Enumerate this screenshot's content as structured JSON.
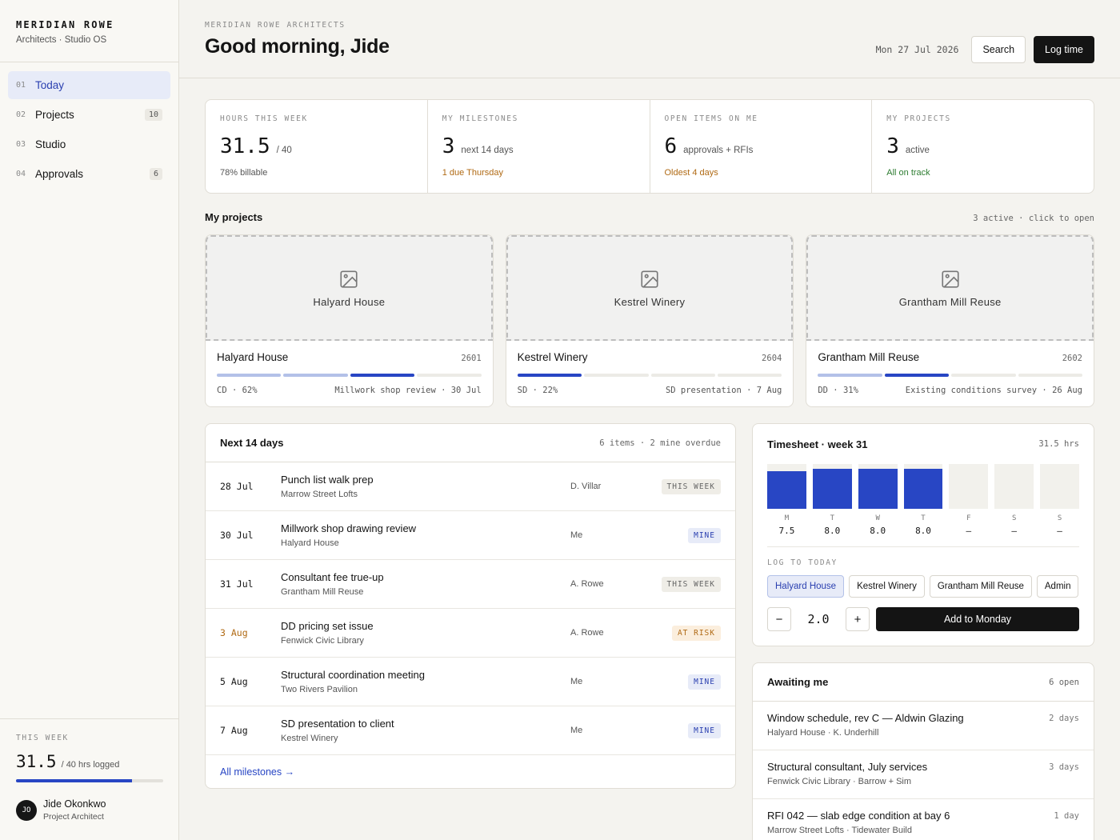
{
  "brand": {
    "name": "MERIDIAN ROWE",
    "sub": "Architects · Studio OS"
  },
  "nav": [
    {
      "num": "01",
      "label": "Today",
      "badge": "",
      "active": true
    },
    {
      "num": "02",
      "label": "Projects",
      "badge": "10"
    },
    {
      "num": "03",
      "label": "Studio",
      "badge": ""
    },
    {
      "num": "04",
      "label": "Approvals",
      "badge": "6"
    }
  ],
  "sidebar_week": {
    "label": "THIS WEEK",
    "hours": "31.5",
    "suffix": "/ 40 hrs logged",
    "progress": 0.7875
  },
  "user": {
    "initials": "JO",
    "name": "Jide Okonkwo",
    "role": "Project Architect"
  },
  "header": {
    "overline": "MERIDIAN ROWE ARCHITECTS",
    "greeting": "Good morning, Jide",
    "date": "Mon 27 Jul 2026",
    "search_label": "Search",
    "log_label": "Log time"
  },
  "stats": [
    {
      "label": "HOURS THIS WEEK",
      "value": "31.5",
      "unit": "/ 40",
      "note": "78% billable",
      "tone": ""
    },
    {
      "label": "MY MILESTONES",
      "value": "3",
      "unit": "next 14 days",
      "note": "1 due Thursday",
      "tone": "amber"
    },
    {
      "label": "OPEN ITEMS ON ME",
      "value": "6",
      "unit": "approvals + RFIs",
      "note": "Oldest 4 days",
      "tone": "amber"
    },
    {
      "label": "MY PROJECTS",
      "value": "3",
      "unit": "active",
      "note": "All on track",
      "tone": "green"
    }
  ],
  "projects_section": {
    "title": "My projects",
    "meta": "3 active · click to open"
  },
  "projects": [
    {
      "name": "Halyard House",
      "code": "2601",
      "phase": "CD · 62%",
      "next": "Millwork shop review · 30 Jul",
      "segments": [
        "done",
        "done",
        "cur",
        "todo"
      ]
    },
    {
      "name": "Kestrel Winery",
      "code": "2604",
      "phase": "SD · 22%",
      "next": "SD presentation · 7 Aug",
      "segments": [
        "cur",
        "todo",
        "todo",
        "todo"
      ]
    },
    {
      "name": "Grantham Mill Reuse",
      "code": "2602",
      "phase": "DD · 31%",
      "next": "Existing conditions survey · 26 Aug",
      "segments": [
        "done",
        "cur",
        "todo",
        "todo"
      ]
    }
  ],
  "milestones": {
    "title": "Next 14 days",
    "meta": "6 items · 2 mine overdue",
    "rows": [
      {
        "date": "28 Jul",
        "title": "Punch list walk prep",
        "project": "Marrow Street Lofts",
        "owner": "D. Villar",
        "tag": "THIS WEEK",
        "kind": "week"
      },
      {
        "date": "30 Jul",
        "title": "Millwork shop drawing review",
        "project": "Halyard House",
        "owner": "Me",
        "tag": "MINE",
        "kind": "mine"
      },
      {
        "date": "31 Jul",
        "title": "Consultant fee true-up",
        "project": "Grantham Mill Reuse",
        "owner": "A. Rowe",
        "tag": "THIS WEEK",
        "kind": "week"
      },
      {
        "date": "3 Aug",
        "title": "DD pricing set issue",
        "project": "Fenwick Civic Library",
        "owner": "A. Rowe",
        "tag": "AT RISK",
        "kind": "risk"
      },
      {
        "date": "5 Aug",
        "title": "Structural coordination meeting",
        "project": "Two Rivers Pavilion",
        "owner": "Me",
        "tag": "MINE",
        "kind": "mine"
      },
      {
        "date": "7 Aug",
        "title": "SD presentation to client",
        "project": "Kestrel Winery",
        "owner": "Me",
        "tag": "MINE",
        "kind": "mine"
      }
    ],
    "link": "All milestones →"
  },
  "timesheet": {
    "title": "Timesheet · week 31",
    "total": "31.5 hrs",
    "max_hours": 9,
    "days": [
      {
        "day": "M",
        "hours": 7.5,
        "label": "7.5"
      },
      {
        "day": "T",
        "hours": 8.0,
        "label": "8.0"
      },
      {
        "day": "W",
        "hours": 8.0,
        "label": "8.0"
      },
      {
        "day": "T",
        "hours": 8.0,
        "label": "8.0"
      },
      {
        "day": "F",
        "hours": 0,
        "label": "—"
      },
      {
        "day": "S",
        "hours": 0,
        "label": "—"
      },
      {
        "day": "S",
        "hours": 0,
        "label": "—"
      }
    ],
    "log_label": "LOG TO TODAY",
    "chips": [
      "Halyard House",
      "Kestrel Winery",
      "Grantham Mill Reuse",
      "Admin"
    ],
    "selected_chip": 0,
    "minus": "−",
    "plus": "+",
    "hours_value": "2.0",
    "add_label": "Add to Monday"
  },
  "awaiting": {
    "title": "Awaiting me",
    "count": "6 open",
    "rows": [
      {
        "title": "Window schedule, rev C — Aldwin Glazing",
        "sub": "Halyard House · K. Underhill",
        "age": "2 days"
      },
      {
        "title": "Structural consultant, July services",
        "sub": "Fenwick Civic Library · Barrow + Sim",
        "age": "3 days"
      },
      {
        "title": "RFI 042 — slab edge condition at bay 6",
        "sub": "Marrow Street Lofts · Tidewater Build",
        "age": "1 day"
      }
    ]
  },
  "colors": {
    "accent": "#2846c4",
    "amber": "#b06a14",
    "green": "#2e7d32",
    "ink": "#141414"
  }
}
